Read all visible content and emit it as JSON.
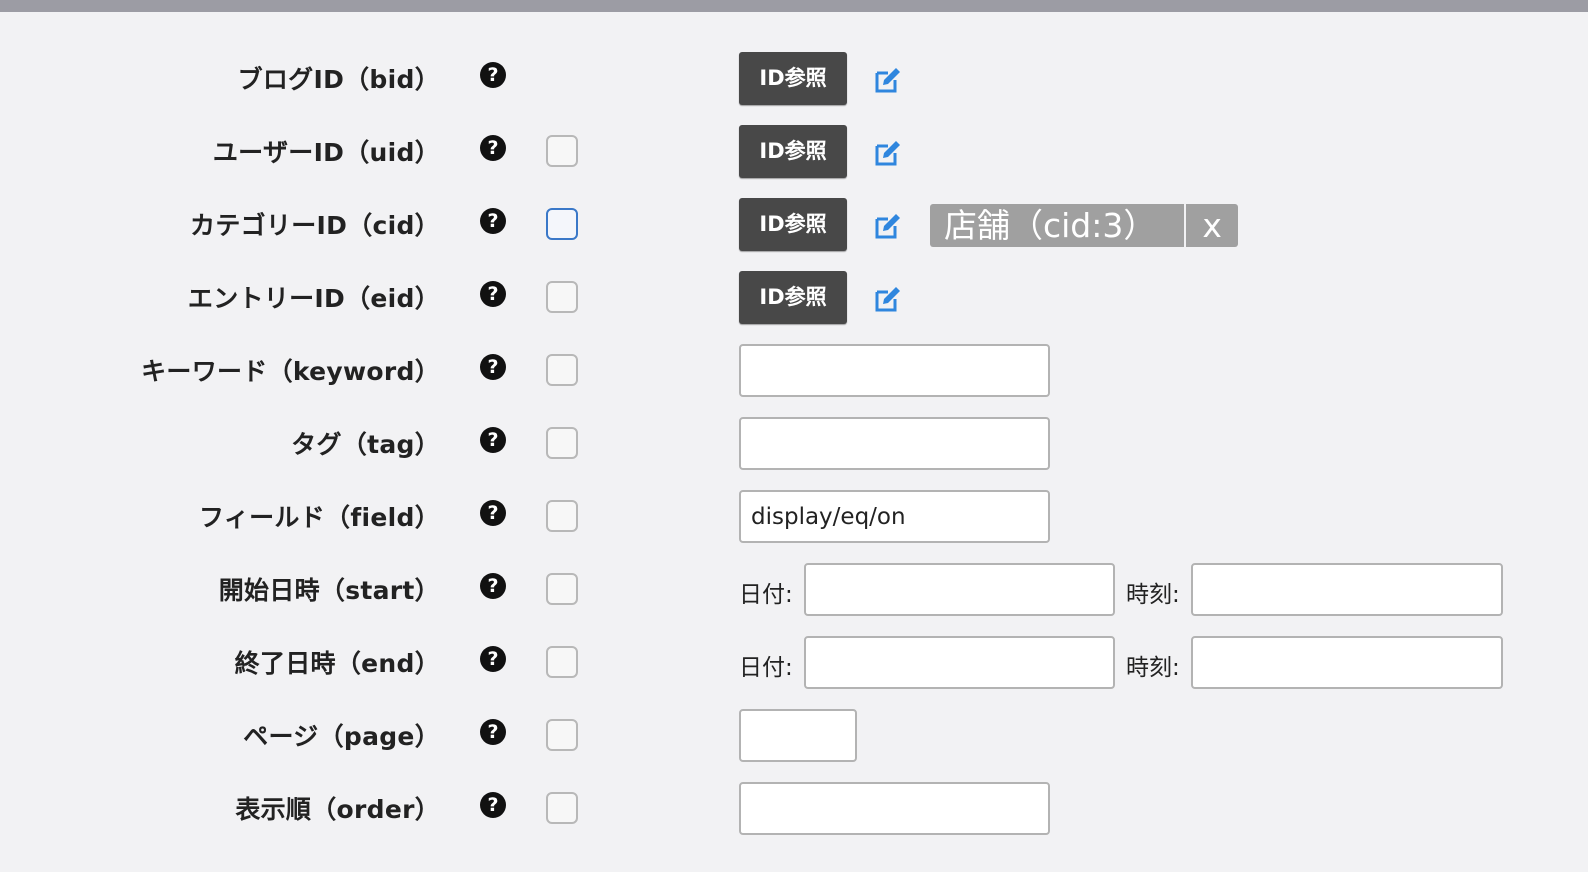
{
  "rows": [
    {
      "label": "ブログID（bid）",
      "has_checkbox": false,
      "control": "id",
      "button_label": "ID参照"
    },
    {
      "label": "ユーザーID（uid）",
      "has_checkbox": true,
      "control": "id",
      "button_label": "ID参照"
    },
    {
      "label": "カテゴリーID（cid）",
      "has_checkbox": true,
      "checkbox_focused": true,
      "control": "id",
      "button_label": "ID参照",
      "selected_tag": {
        "text": "店舗（cid:3）",
        "remove": "x"
      }
    },
    {
      "label": "エントリーID（eid）",
      "has_checkbox": true,
      "control": "id",
      "button_label": "ID参照"
    },
    {
      "label": "キーワード（keyword）",
      "has_checkbox": true,
      "control": "text",
      "value": ""
    },
    {
      "label": "タグ（tag）",
      "has_checkbox": true,
      "control": "text",
      "value": ""
    },
    {
      "label": "フィールド（field）",
      "has_checkbox": true,
      "control": "text",
      "value": "display/eq/on"
    },
    {
      "label": "開始日時（start）",
      "has_checkbox": true,
      "control": "datetime",
      "date_label": "日付:",
      "time_label": "時刻:",
      "date_value": "",
      "time_value": ""
    },
    {
      "label": "終了日時（end）",
      "has_checkbox": true,
      "control": "datetime",
      "date_label": "日付:",
      "time_label": "時刻:",
      "date_value": "",
      "time_value": ""
    },
    {
      "label": "ページ（page）",
      "has_checkbox": true,
      "control": "short",
      "value": ""
    },
    {
      "label": "表示順（order）",
      "has_checkbox": true,
      "control": "text",
      "value": ""
    }
  ],
  "help_icon": "question-circle-icon",
  "help_glyph": "?",
  "edit_icon": "edit-pencil-icon",
  "colors": {
    "topbar": "#9c9ca4",
    "background": "#f2f2f4",
    "id_button": "#484848",
    "edit_icon": "#2f86de",
    "tag": "#a0a0a0",
    "focus_border": "#3a78c8"
  }
}
